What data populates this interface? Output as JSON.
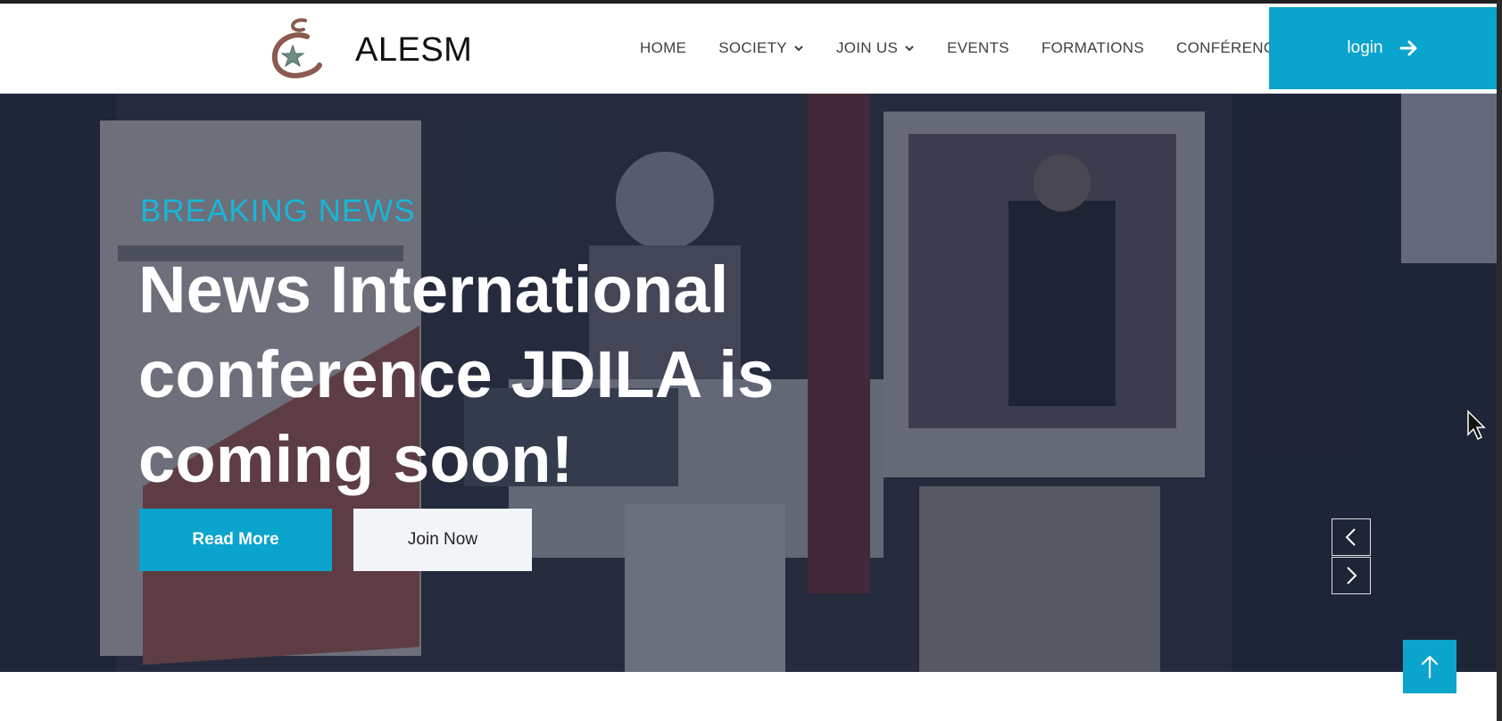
{
  "brand": {
    "name": "ALESM",
    "logo_icon": "alesm-logo-icon"
  },
  "nav": {
    "items": [
      {
        "label": "HOME",
        "has_dropdown": false
      },
      {
        "label": "SOCIETY",
        "has_dropdown": true
      },
      {
        "label": "JOIN US",
        "has_dropdown": true
      },
      {
        "label": "EVENTS",
        "has_dropdown": false
      },
      {
        "label": "FORMATIONS",
        "has_dropdown": false
      },
      {
        "label": "CONFÉRENCES",
        "has_dropdown": false
      }
    ],
    "login_label": "login",
    "login_icon": "arrow-right-icon"
  },
  "hero": {
    "kicker": "BREAKING NEWS",
    "headline": "News International conference JDILA is coming soon!",
    "read_more_label": "Read More",
    "join_now_label": "Join Now",
    "prev_icon": "chevron-left-icon",
    "next_icon": "chevron-right-icon"
  },
  "back_to_top_icon": "arrow-up-icon",
  "colors": {
    "accent": "#0aa4cc",
    "kicker": "#18b6d8",
    "overlay": "#141c32"
  }
}
